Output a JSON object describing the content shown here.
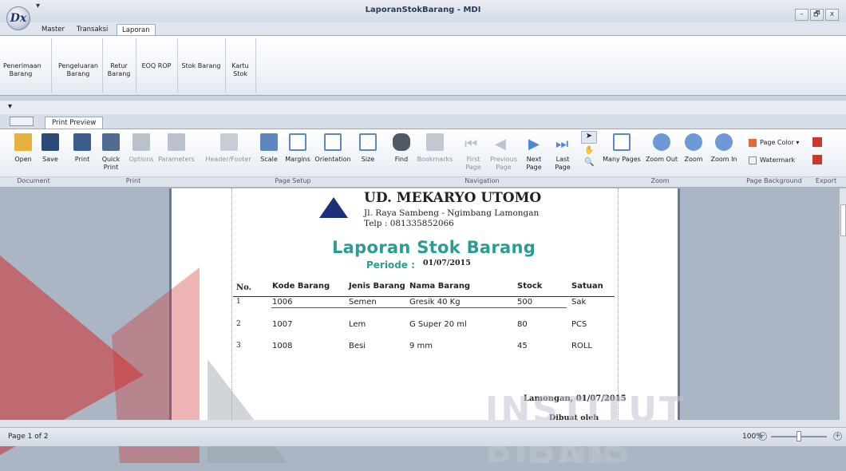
{
  "window": {
    "title": "LaporanStokBarang - MDI",
    "qat_arrow": "▾",
    "app_glyph": "Dx",
    "min": "–",
    "max": "🗗",
    "close": "x"
  },
  "main_tabs": [
    "Master",
    "Transaksi",
    "Laporan"
  ],
  "main_ribbon": [
    {
      "label": "Penerimaan\nBarang"
    },
    {
      "label": "Pengeluaran\nBarang"
    },
    {
      "label": "Retur\nBarang"
    },
    {
      "label": "EOQ ROP"
    },
    {
      "label": "Stok Barang"
    },
    {
      "label": "Kartu\nStok"
    }
  ],
  "inner_tab": "Print Preview",
  "toolbar": {
    "open": "Open",
    "save": "Save",
    "print": "Print",
    "quick_print": "Quick\nPrint",
    "options": "Options",
    "parameters": "Parameters",
    "header_footer": "Header/Footer",
    "scale": "Scale",
    "margins": "Margins",
    "orientation": "Orientation",
    "size": "Size",
    "find": "Find",
    "bookmarks": "Bookmarks",
    "first_page": "First\nPage",
    "previous_page": "Previous\nPage",
    "next_page": "Next\nPage",
    "last_page": "Last\nPage",
    "many_pages": "Many Pages",
    "zoom_out": "Zoom Out",
    "zoom": "Zoom",
    "zoom_in": "Zoom In",
    "page_color": "Page Color ▾",
    "watermark": "Watermark"
  },
  "groups": [
    "Document",
    "Print",
    "Page Setup",
    "Navigation",
    "Zoom",
    "Page Background",
    "Export"
  ],
  "report": {
    "company": "UD. MEKARYO UTOMO",
    "address": "Jl. Raya Sambeng - Ngimbang Lamongan",
    "phone": "Telp : 081335852066",
    "title": "Laporan Stok Barang",
    "periode_label": "Periode :",
    "periode_value": "01/07/2015",
    "columns": [
      "No.",
      "Kode Barang",
      "Jenis Barang",
      "Nama Barang",
      "Stock",
      "Satuan"
    ],
    "rows": [
      [
        "1",
        "1006",
        "Semen",
        "Gresik 40 Kg",
        "500",
        "Sak"
      ],
      [
        "2",
        "1007",
        "Lem",
        "G Super 20 ml",
        "80",
        "PCS"
      ],
      [
        "3",
        "1008",
        "Besi",
        "9 mm",
        "45",
        "ROLL"
      ]
    ],
    "footer_place_date": "Lamongan, 01/07/2015",
    "footer_made_by": "Dibuat oleh"
  },
  "status": {
    "page": "Page 1 of 2",
    "zoom": "100%"
  },
  "watermark": {
    "line1": "INSTITUT BISNIS",
    "line2": "DAN INFORMATIKA"
  },
  "colors": {
    "accent_teal": "#2a9d93",
    "logo_navy": "#1c2f7a",
    "watermark_red": "#cf2b2b"
  }
}
